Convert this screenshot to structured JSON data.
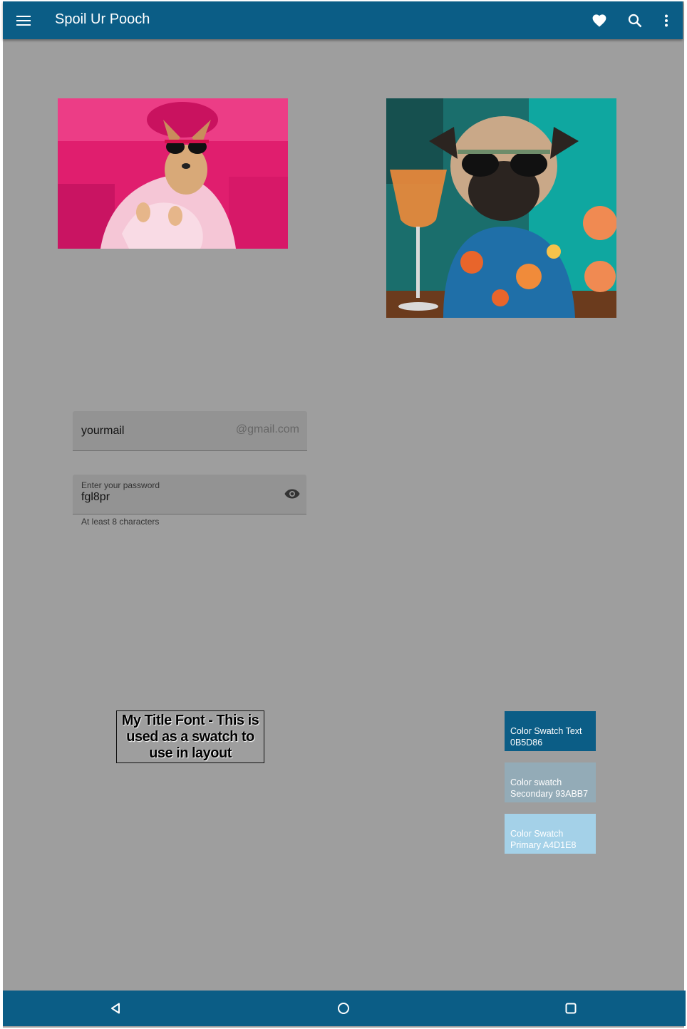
{
  "app_bar": {
    "title": "Spoil Ur Pooch",
    "menu_icon": "menu-icon",
    "actions": [
      "heart-icon",
      "search-icon",
      "more-vert-icon"
    ]
  },
  "images": [
    {
      "description": "chihuahua-in-bathrobe-photo"
    },
    {
      "description": "pug-in-hawaiian-shirt-photo"
    }
  ],
  "email_field": {
    "value": "yourmail",
    "suffix": "@gmail.com"
  },
  "password_field": {
    "label": "Enter your password",
    "value": "fgl8pr",
    "helper": "At least 8 characters",
    "toggle_icon": "eye-icon"
  },
  "title_font_sample": "My Title Font - This is used as a swatch to use in layout",
  "swatches": [
    {
      "text": "Color Swatch Text 0B5D86",
      "color": "#0b5d86",
      "text_color": "#ffffff"
    },
    {
      "text": "Color swatch Secondary 93ABB7",
      "color": "#93abb7",
      "text_color": "#ffffff"
    },
    {
      "text": "Color Swatch Primary A4D1E8",
      "color": "#a4d1e8",
      "text_color": "#ffffff"
    }
  ],
  "nav_bar": {
    "buttons": [
      "back-icon",
      "home-icon",
      "recents-icon"
    ]
  },
  "colors": {
    "primary_dark": "#0b5d86",
    "background": "#9e9e9e"
  }
}
